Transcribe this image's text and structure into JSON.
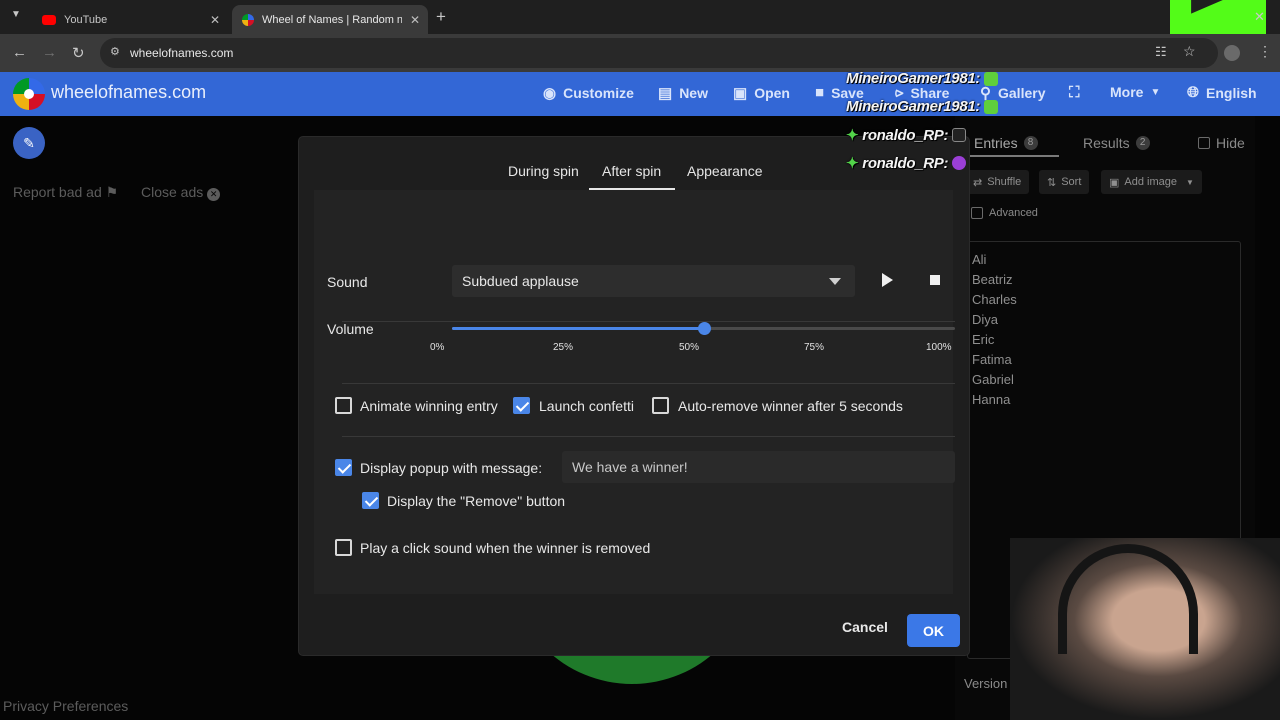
{
  "browser": {
    "tabs": [
      {
        "title": "YouTube",
        "active": false
      },
      {
        "title": "Wheel of Names | Random nam",
        "active": true
      }
    ],
    "url": "wheelofnames.com"
  },
  "app": {
    "site_name": "wheelofnames.com",
    "nav": {
      "customize": "Customize",
      "new": "New",
      "open": "Open",
      "save": "Save",
      "share": "Share",
      "gallery": "Gallery",
      "more": "More",
      "language": "English"
    },
    "ads": {
      "report": "Report bad ad",
      "close": "Close ads"
    },
    "privacy": "Privacy Preferences",
    "version": "Version"
  },
  "right_panel": {
    "tabs": {
      "entries": {
        "label": "Entries",
        "count": "8"
      },
      "results": {
        "label": "Results",
        "count": "2"
      },
      "hide": "Hide"
    },
    "buttons": {
      "shuffle": "Shuffle",
      "sort": "Sort",
      "add_image": "Add image"
    },
    "advanced": "Advanced",
    "entries": [
      "Ali",
      "Beatriz",
      "Charles",
      "Diya",
      "Eric",
      "Fatima",
      "Gabriel",
      "Hanna"
    ]
  },
  "dialog": {
    "tabs": [
      "During spin",
      "After spin",
      "Appearance"
    ],
    "active_tab": "After spin",
    "sound": {
      "label": "Sound",
      "value": "Subdued applause"
    },
    "volume": {
      "label": "Volume",
      "value_percent": 50,
      "ticks": [
        "0%",
        "25%",
        "50%",
        "75%",
        "100%"
      ]
    },
    "options": {
      "animate_winning_entry": {
        "label": "Animate winning entry",
        "checked": false
      },
      "launch_confetti": {
        "label": "Launch confetti",
        "checked": true
      },
      "auto_remove": {
        "label": "Auto-remove winner after 5 seconds",
        "checked": false
      },
      "display_popup": {
        "label": "Display popup with message:",
        "checked": true,
        "message": "We have a winner!"
      },
      "display_remove": {
        "label": "Display the \"Remove\" button",
        "checked": true
      },
      "click_sound": {
        "label": "Play a click sound when the winner is removed",
        "checked": false
      }
    },
    "cancel": "Cancel",
    "ok": "OK"
  },
  "overlay": {
    "chat": [
      {
        "user": "MineiroGamer1981:"
      },
      {
        "user": "MineiroGamer1981:"
      },
      {
        "user": "ronaldo_RP:"
      },
      {
        "user": "ronaldo_RP:"
      }
    ]
  },
  "colors": {
    "accent": "#3b78e7",
    "header": "#3367d6",
    "dialog_bg": "#1e1e1e"
  }
}
